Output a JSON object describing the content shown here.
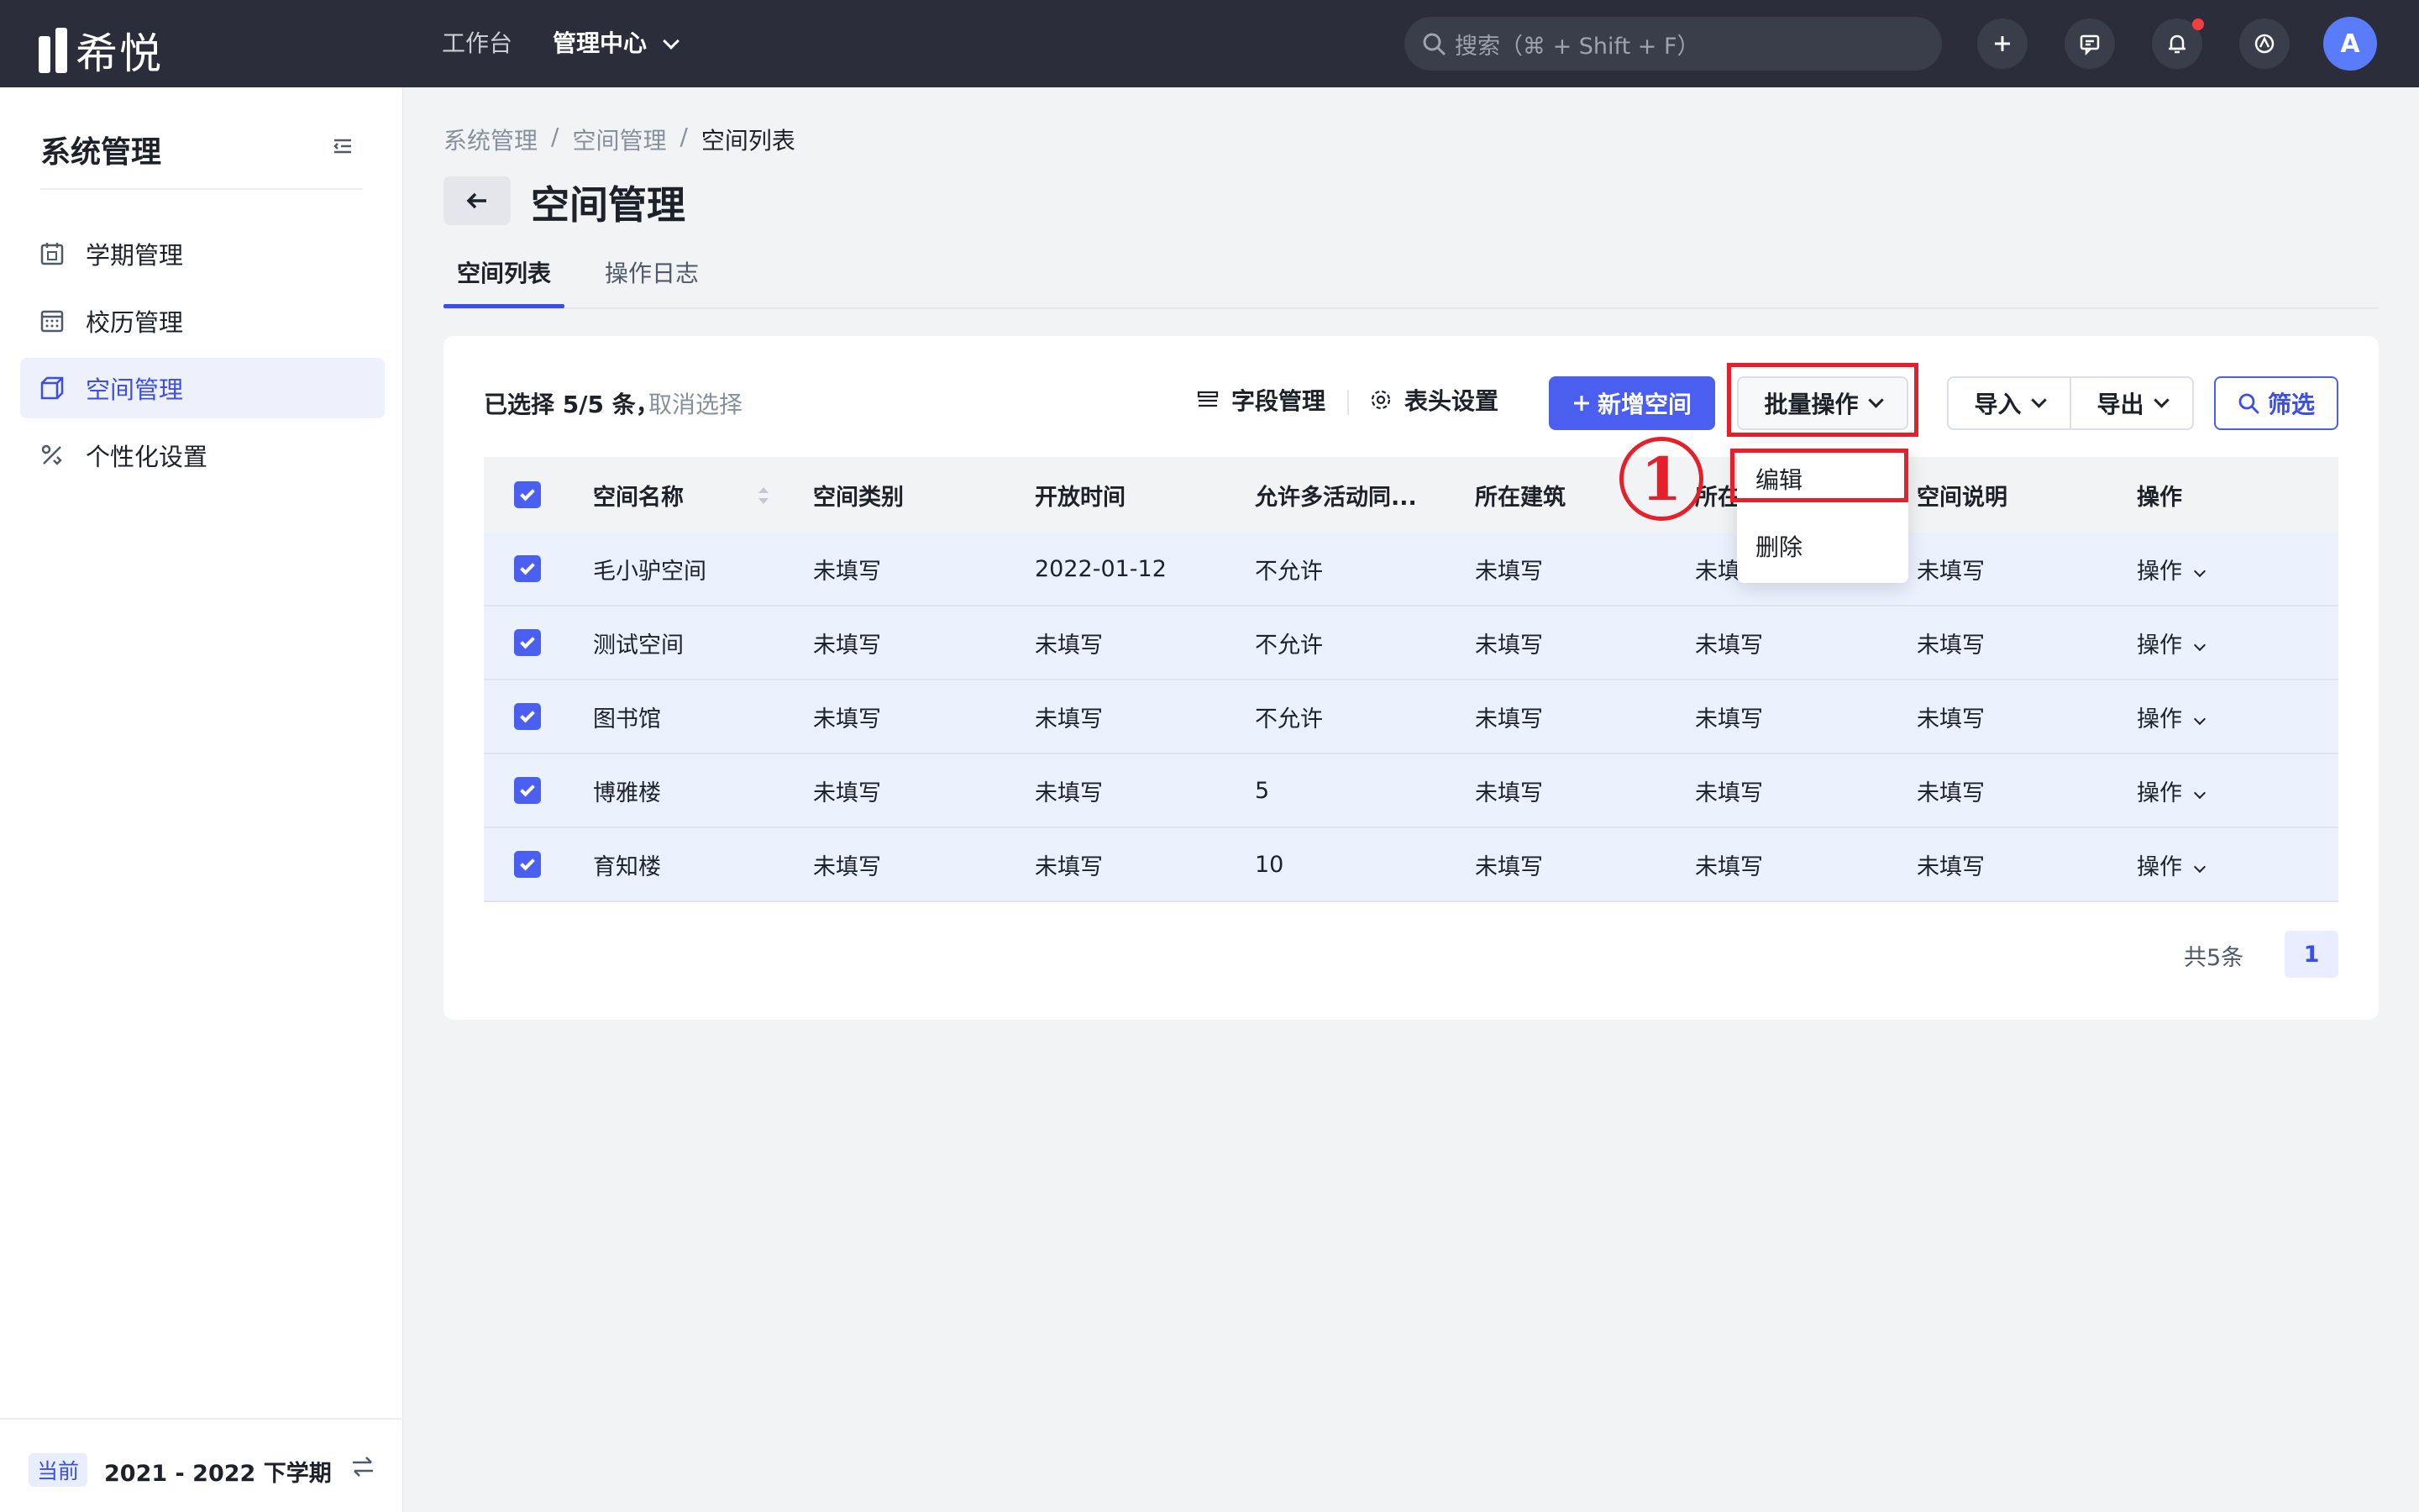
{
  "app": {
    "logo_text": "希悦"
  },
  "topnav": {
    "workbench": "工作台",
    "admin_center": "管理中心",
    "search_placeholder": "搜索（⌘ + Shift + F）",
    "avatar": "A"
  },
  "sidebar": {
    "title": "系统管理",
    "items": [
      {
        "label": "学期管理",
        "icon": "calendar-icon"
      },
      {
        "label": "校历管理",
        "icon": "grid-calendar-icon"
      },
      {
        "label": "空间管理",
        "icon": "cube-icon",
        "active": true
      },
      {
        "label": "个性化设置",
        "icon": "tools-icon"
      }
    ],
    "term_tag": "当前",
    "term_text": "2021 - 2022 下学期"
  },
  "breadcrumb": [
    "系统管理",
    "空间管理",
    "空间列表"
  ],
  "page_title": "空间管理",
  "tabs": [
    "空间列表",
    "操作日志"
  ],
  "toolbar": {
    "selected": "已选择 5/5 条，",
    "cancel": "取消选择",
    "field_manage": "字段管理",
    "header_settings": "表头设置",
    "add_space": "新增空间",
    "batch": "批量操作",
    "import": "导入",
    "export": "导出",
    "filter": "筛选"
  },
  "table": {
    "headers": [
      "空间名称",
      "空间类别",
      "开放时间",
      "允许多活动同...",
      "所在建筑",
      "所在",
      "空间说明",
      "操作"
    ],
    "rows": [
      [
        "毛小驴空间",
        "未填写",
        "2022-01-12",
        "不允许",
        "未填写",
        "未填",
        "未填写",
        "操作"
      ],
      [
        "测试空间",
        "未填写",
        "未填写",
        "不允许",
        "未填写",
        "未填写",
        "未填写",
        "操作"
      ],
      [
        "图书馆",
        "未填写",
        "未填写",
        "不允许",
        "未填写",
        "未填写",
        "未填写",
        "操作"
      ],
      [
        "博雅楼",
        "未填写",
        "未填写",
        "5",
        "未填写",
        "未填写",
        "未填写",
        "操作"
      ],
      [
        "育知楼",
        "未填写",
        "未填写",
        "10",
        "未填写",
        "未填写",
        "未填写",
        "操作"
      ]
    ]
  },
  "pager": {
    "total": "共5条",
    "page": "1"
  },
  "dropdown": {
    "items": [
      "编辑",
      "删除"
    ]
  },
  "annotation": {
    "marker": "1"
  },
  "colors": {
    "primary": "#4a5ff0",
    "highlight": "#e5202a",
    "topbar": "#2b2e3a"
  }
}
